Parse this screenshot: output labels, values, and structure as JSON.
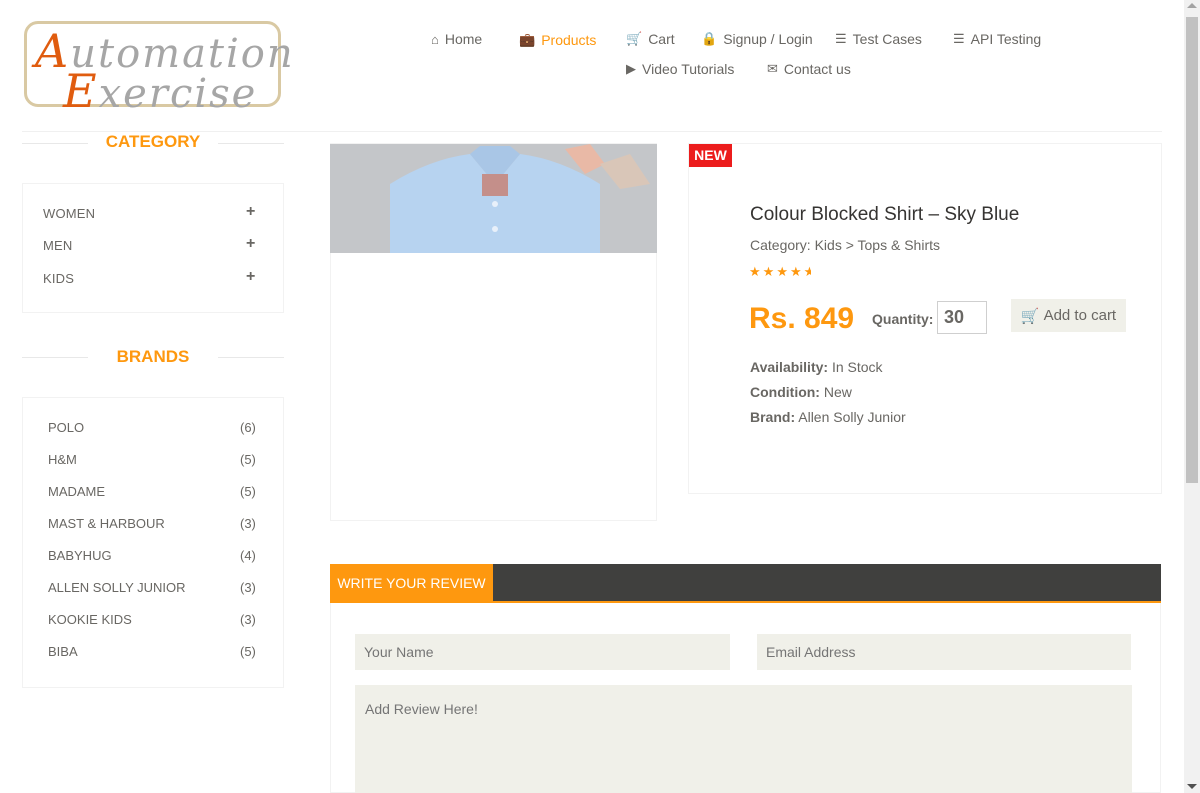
{
  "logo": {
    "line1_cap": "A",
    "line1_rest": "utomation",
    "line2_cap": "E",
    "line2_rest": "xercise"
  },
  "nav": [
    {
      "icon": "home-icon",
      "label": "Home"
    },
    {
      "icon": "briefcase-icon",
      "label": "Products"
    },
    {
      "icon": "cart-icon",
      "label": "Cart"
    },
    {
      "icon": "lock-icon",
      "label": "Signup / Login"
    },
    {
      "icon": "list-icon",
      "label": "Test Cases"
    },
    {
      "icon": "list-icon",
      "label": "API Testing"
    },
    {
      "icon": "youtube-icon",
      "label": "Video Tutorials"
    },
    {
      "icon": "envelope-icon",
      "label": "Contact us"
    }
  ],
  "sidebar": {
    "category_title": "CATEGORY",
    "categories": [
      "WOMEN",
      "MEN",
      "KIDS"
    ],
    "brands_title": "BRANDS",
    "brands": [
      {
        "name": "POLO",
        "count": "(6)"
      },
      {
        "name": "H&M",
        "count": "(5)"
      },
      {
        "name": "MADAME",
        "count": "(5)"
      },
      {
        "name": "MAST & HARBOUR",
        "count": "(3)"
      },
      {
        "name": "BABYHUG",
        "count": "(4)"
      },
      {
        "name": "ALLEN SOLLY JUNIOR",
        "count": "(3)"
      },
      {
        "name": "KOOKIE KIDS",
        "count": "(3)"
      },
      {
        "name": "BIBA",
        "count": "(5)"
      }
    ]
  },
  "product": {
    "badge": "NEW",
    "name": "Colour Blocked Shirt – Sky Blue",
    "category": "Category: Kids > Tops & Shirts",
    "rating": 4.5,
    "price": "Rs. 849",
    "quantity_label": "Quantity:",
    "quantity": "30",
    "add_to_cart": "Add to cart",
    "availability_label": "Availability:",
    "availability": "In Stock",
    "condition_label": "Condition:",
    "condition": "New",
    "brand_label": "Brand:",
    "brand": "Allen Solly Junior"
  },
  "review": {
    "tab": "WRITE YOUR REVIEW",
    "name_placeholder": "Your Name",
    "email_placeholder": "Email Address",
    "review_placeholder": "Add Review Here!"
  },
  "colors": {
    "accent": "#fe980f",
    "badge": "#ec1c1c",
    "dark_bar": "#40403e"
  }
}
